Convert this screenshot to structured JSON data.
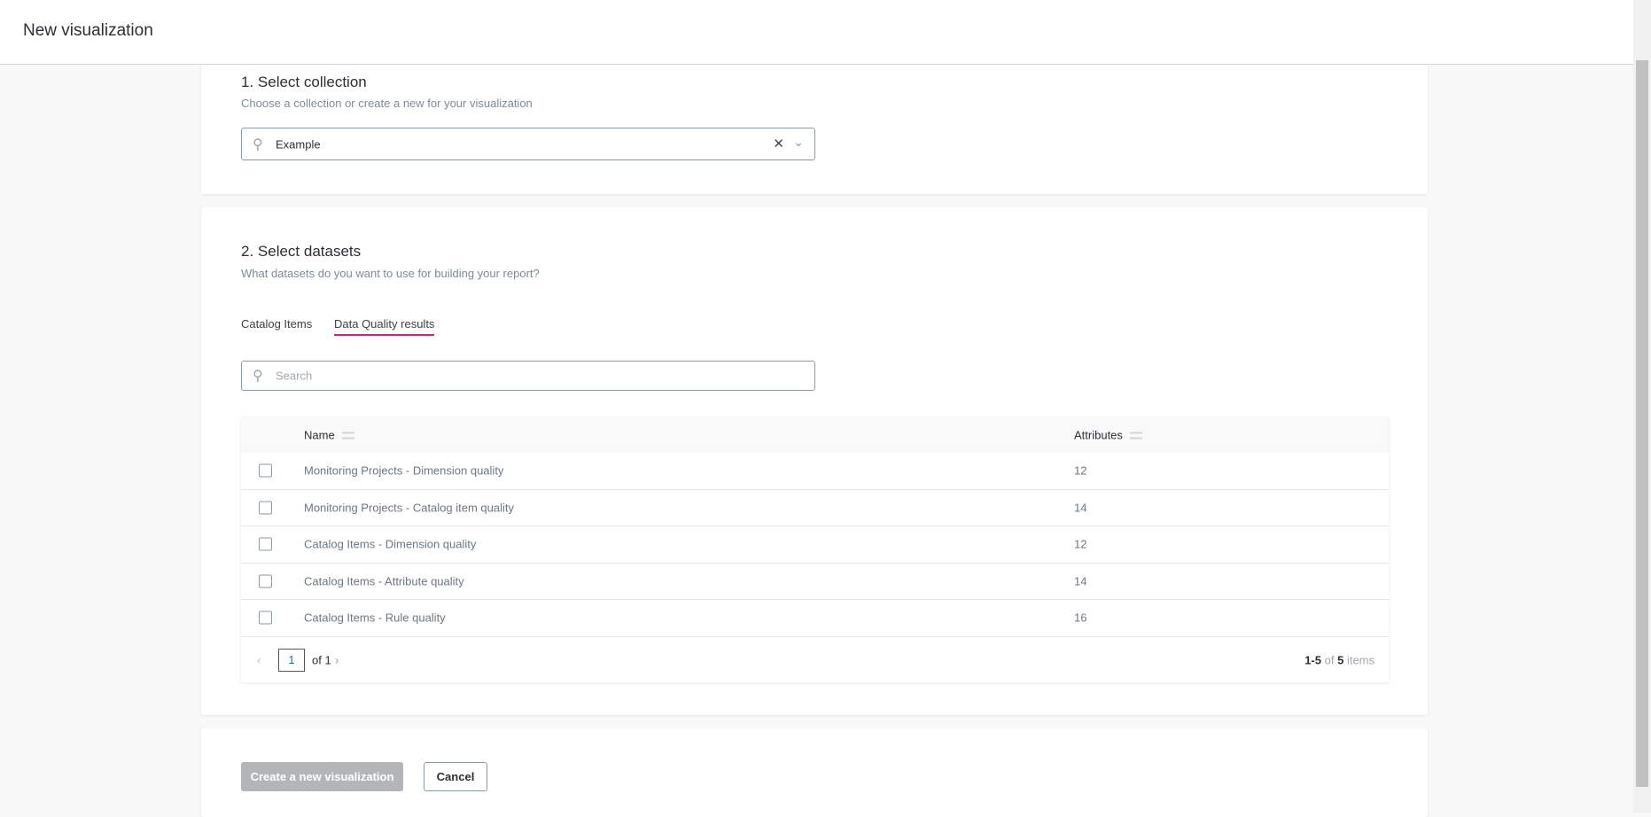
{
  "header": {
    "title": "New visualization"
  },
  "collection": {
    "heading": "1. Select collection",
    "subtitle": "Choose a collection or create a new for your visualization",
    "value": "Example"
  },
  "datasets": {
    "heading": "2. Select datasets",
    "subtitle": "What datasets do you want to use for building your report?",
    "tabs": [
      {
        "label": "Catalog Items",
        "active": false
      },
      {
        "label": "Data Quality results",
        "active": true
      }
    ],
    "search_placeholder": "Search",
    "columns": [
      "Name",
      "Attributes"
    ],
    "rows": [
      {
        "name": "Monitoring Projects - Dimension quality",
        "attributes": "12"
      },
      {
        "name": "Monitoring Projects - Catalog item quality",
        "attributes": "14"
      },
      {
        "name": "Catalog Items - Dimension quality",
        "attributes": "12"
      },
      {
        "name": "Catalog Items - Attribute quality",
        "attributes": "14"
      },
      {
        "name": "Catalog Items - Rule quality",
        "attributes": "16"
      }
    ],
    "pagination": {
      "page": "1",
      "of": "of 1",
      "range": "1-5",
      "of_label": "of",
      "total": "5",
      "items_label": "items"
    }
  },
  "actions": {
    "create": "Create a new visualization",
    "cancel": "Cancel"
  },
  "colors": {
    "accent": "#e0197d",
    "disabled_button": "#b3b5b9"
  }
}
